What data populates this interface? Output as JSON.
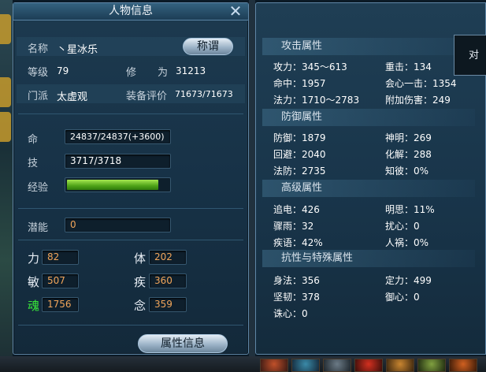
{
  "window_title": "人物信息",
  "close_glyph": "✕",
  "profile": {
    "name_label": "名称",
    "name_value": "丶星冰乐",
    "title_button": "称谓",
    "level_label": "等级",
    "level_value": "79",
    "cultivation_label_1": "修",
    "cultivation_label_2": "为",
    "cultivation_value": "31213",
    "sect_label": "门派",
    "sect_value": "太虚观",
    "gear_score_label": "装备评价",
    "gear_score_value": "71673/71673"
  },
  "vitals": {
    "hp_label": "命",
    "hp_value": "24837/24837(+3600)",
    "skill_label": "技",
    "skill_value": "3717/3718",
    "exp_label": "经验",
    "exp_fraction": 0.9,
    "potential_label": "潜能",
    "potential_value": "0"
  },
  "attributes": {
    "strength_label": "力",
    "strength_value": "82",
    "constitution_label": "体",
    "constitution_value": "202",
    "agility_label": "敏",
    "agility_value": "507",
    "speed_label": "疾",
    "speed_value": "360",
    "soul_label": "魂",
    "soul_value": "1756",
    "mind_label": "念",
    "mind_value": "359"
  },
  "attr_info_button": "属性信息",
  "attack": {
    "header": "攻击属性",
    "attack": "攻力：345～613",
    "heavy_hit": "重击：134",
    "hit": "命中：1957",
    "crit": "会心一击：1354",
    "magic": "法力：1710～2783",
    "extra_damage": "附加伤害：249"
  },
  "defense": {
    "header": "防御属性",
    "defense": "防御：1879",
    "spirit": "神明：269",
    "dodge": "回避：2040",
    "dissolve": "化解：288",
    "magic_def": "法防：2735",
    "insight": "知彼：0%"
  },
  "advanced": {
    "header": "高级属性",
    "pursuit": "追电：426",
    "clarity": "明思：11%",
    "storm": "骤雨：32",
    "disturb": "扰心：0",
    "swift_words": "疾语：42%",
    "human_bane": "人祸：0%"
  },
  "resistance": {
    "header": "抗性与特殊属性",
    "body_art": "身法：356",
    "focus": "定力：499",
    "toughness": "坚韧：378",
    "guard_mind": "御心：0",
    "punish_mind": "诛心：0"
  },
  "popup_text": "对同",
  "colors": {
    "accent_orange": "#f1a55a",
    "soul_green": "#39e83a",
    "exp_green": "#5cb020"
  }
}
